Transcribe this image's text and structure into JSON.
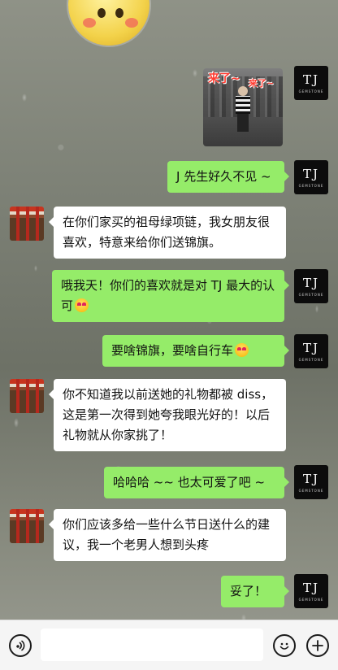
{
  "image_message": {
    "caption_1": "来了~",
    "caption_2": "来了~"
  },
  "messages": [
    {
      "side": "right",
      "text": "J 先生好久不见 ~"
    },
    {
      "side": "left",
      "text": "在你们家买的祖母绿项链，我女朋友很喜欢，特意来给你们送锦旗。"
    },
    {
      "side": "right",
      "text": "哦我天！你们的喜欢就是对 TJ 最大的认可"
    },
    {
      "side": "right",
      "text": "要啥锦旗，要啥自行车"
    },
    {
      "side": "left",
      "text": "你不知道我以前送她的礼物都被 diss，这是第一次得到她夸我眼光好的！以后礼物就从你家挑了！"
    },
    {
      "side": "right",
      "text": "哈哈哈 ~~ 也太可爱了吧 ~"
    },
    {
      "side": "left",
      "text": "你们应该多给一些什么节日送什么的建议，我一个老男人想到头疼"
    },
    {
      "side": "right",
      "text": "妥了！"
    }
  ],
  "avatar_tj": {
    "logo": "TJ",
    "subtitle": "GEMSTONE"
  },
  "input_bar": {
    "voice_icon": "voice-icon",
    "emoji_icon": "emoji-icon",
    "plus_icon": "plus-icon",
    "input_value": ""
  },
  "colors": {
    "right_bubble": "#95ec69",
    "left_bubble": "#ffffff",
    "tj_avatar": "#0c0c0c"
  }
}
